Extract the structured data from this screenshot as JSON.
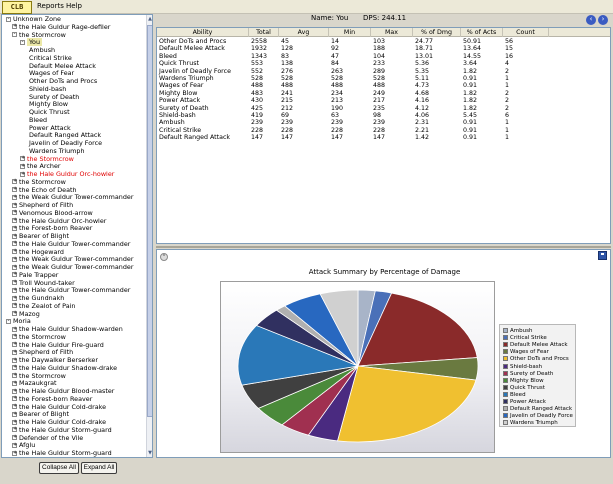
{
  "menu": {
    "logo": "CLB",
    "items": [
      "Reports",
      "Help"
    ]
  },
  "tree": {
    "rows": [
      {
        "label": "Unknown Zone",
        "level": 0,
        "box": "-",
        "color": "normal"
      },
      {
        "label": "the Hale Guldur Rage-defiler",
        "level": 1,
        "box": "+",
        "color": "normal"
      },
      {
        "label": "the Stormcrow",
        "level": 1,
        "box": "-",
        "color": "normal"
      },
      {
        "label": "You",
        "level": 2,
        "box": "-",
        "color": "selected"
      },
      {
        "label": "Ambush",
        "level": 3,
        "box": "",
        "color": "normal"
      },
      {
        "label": "Critical Strike",
        "level": 3,
        "box": "",
        "color": "normal"
      },
      {
        "label": "Default Melee Attack",
        "level": 3,
        "box": "",
        "color": "normal"
      },
      {
        "label": "Wages of Fear",
        "level": 3,
        "box": "",
        "color": "normal"
      },
      {
        "label": "Other DoTs and Procs",
        "level": 3,
        "box": "",
        "color": "normal"
      },
      {
        "label": "Shield-bash",
        "level": 3,
        "box": "",
        "color": "normal"
      },
      {
        "label": "Surety of Death",
        "level": 3,
        "box": "",
        "color": "normal"
      },
      {
        "label": "Mighty Blow",
        "level": 3,
        "box": "",
        "color": "normal"
      },
      {
        "label": "Quick Thrust",
        "level": 3,
        "box": "",
        "color": "normal"
      },
      {
        "label": "Bleed",
        "level": 3,
        "box": "",
        "color": "normal"
      },
      {
        "label": "Power Attack",
        "level": 3,
        "box": "",
        "color": "normal"
      },
      {
        "label": "Default Ranged Attack",
        "level": 3,
        "box": "",
        "color": "normal"
      },
      {
        "label": "Javelin of Deadly Force",
        "level": 3,
        "box": "",
        "color": "normal"
      },
      {
        "label": "Wardens Triumph",
        "level": 3,
        "box": "",
        "color": "normal"
      },
      {
        "label": "the Stormcrow",
        "level": 2,
        "box": "+",
        "color": "red"
      },
      {
        "label": "the Archer",
        "level": 2,
        "box": "+",
        "color": "normal"
      },
      {
        "label": "the Hale Guldur Orc-howler",
        "level": 2,
        "box": "+",
        "color": "red"
      },
      {
        "label": "the Stormcrow",
        "level": 1,
        "box": "+",
        "color": "normal"
      },
      {
        "label": "the Echo of Death",
        "level": 1,
        "box": "+",
        "color": "normal"
      },
      {
        "label": "the Weak Guldur Tower-commander",
        "level": 1,
        "box": "+",
        "color": "normal"
      },
      {
        "label": "Shepherd of Filth",
        "level": 1,
        "box": "+",
        "color": "normal"
      },
      {
        "label": "Venomous Blood-arrow",
        "level": 1,
        "box": "+",
        "color": "normal"
      },
      {
        "label": "the Hale Guldur Orc-howler",
        "level": 1,
        "box": "+",
        "color": "normal"
      },
      {
        "label": "the Forest-born Reaver",
        "level": 1,
        "box": "+",
        "color": "normal"
      },
      {
        "label": "Bearer of Blight",
        "level": 1,
        "box": "+",
        "color": "normal"
      },
      {
        "label": "the Hale Guldur Tower-commander",
        "level": 1,
        "box": "+",
        "color": "normal"
      },
      {
        "label": "the Hogeward",
        "level": 1,
        "box": "+",
        "color": "normal"
      },
      {
        "label": "the Weak Guldur Tower-commander",
        "level": 1,
        "box": "+",
        "color": "normal"
      },
      {
        "label": "the Weak Guldur Tower-commander",
        "level": 1,
        "box": "+",
        "color": "normal"
      },
      {
        "label": "Pale Trapper",
        "level": 1,
        "box": "+",
        "color": "normal"
      },
      {
        "label": "Troll Wound-taker",
        "level": 1,
        "box": "+",
        "color": "normal"
      },
      {
        "label": "the Hale Guldur Tower-commander",
        "level": 1,
        "box": "+",
        "color": "normal"
      },
      {
        "label": "the Gundnakh",
        "level": 1,
        "box": "+",
        "color": "normal"
      },
      {
        "label": "the Zealot of Pain",
        "level": 1,
        "box": "+",
        "color": "normal"
      },
      {
        "label": "Mazog",
        "level": 1,
        "box": "+",
        "color": "normal"
      },
      {
        "label": "Moria",
        "level": 0,
        "box": "-",
        "color": "normal"
      },
      {
        "label": "the Hale Guldur Shadow-warden",
        "level": 1,
        "box": "+",
        "color": "normal"
      },
      {
        "label": "the Stormcrow",
        "level": 1,
        "box": "+",
        "color": "normal"
      },
      {
        "label": "the Hale Guldur Fire-guard",
        "level": 1,
        "box": "+",
        "color": "normal"
      },
      {
        "label": "Shepherd of Filth",
        "level": 1,
        "box": "+",
        "color": "normal"
      },
      {
        "label": "the Daywalker Berserker",
        "level": 1,
        "box": "+",
        "color": "normal"
      },
      {
        "label": "the Hale Guldur Shadow-drake",
        "level": 1,
        "box": "+",
        "color": "normal"
      },
      {
        "label": "the Stormcrow",
        "level": 1,
        "box": "+",
        "color": "normal"
      },
      {
        "label": "Mazaukgrat",
        "level": 1,
        "box": "+",
        "color": "normal"
      },
      {
        "label": "the Hale Guldur Blood-master",
        "level": 1,
        "box": "+",
        "color": "normal"
      },
      {
        "label": "the Forest-born Reaver",
        "level": 1,
        "box": "+",
        "color": "normal"
      },
      {
        "label": "the Hale Guldur Cold-drake",
        "level": 1,
        "box": "+",
        "color": "normal"
      },
      {
        "label": "Bearer of Blight",
        "level": 1,
        "box": "+",
        "color": "normal"
      },
      {
        "label": "the Hale Guldur Cold-drake",
        "level": 1,
        "box": "+",
        "color": "normal"
      },
      {
        "label": "the Hale Guldur Storm-guard",
        "level": 1,
        "box": "+",
        "color": "normal"
      },
      {
        "label": "Defender of the Vile",
        "level": 1,
        "box": "+",
        "color": "normal"
      },
      {
        "label": "Afglu",
        "level": 1,
        "box": "+",
        "color": "normal"
      },
      {
        "label": "the Hale Guldur Storm-guard",
        "level": 1,
        "box": "+",
        "color": "normal"
      }
    ]
  },
  "buttons": {
    "collapse_all": "Collapse All",
    "expand_all": "Expand All"
  },
  "header": {
    "name_label": "Name: You",
    "dps_label": "DPS: 244.11"
  },
  "table": {
    "columns": [
      "Ability",
      "Total",
      "Avg",
      "Min",
      "Max",
      "% of Dmg",
      "% of Acts",
      "Count"
    ],
    "rows": [
      [
        "Other DoTs and Procs",
        "2558",
        "45",
        "14",
        "103",
        "24.77",
        "50.91",
        "56"
      ],
      [
        "Default Melee Attack",
        "1932",
        "128",
        "92",
        "188",
        "18.71",
        "13.64",
        "15"
      ],
      [
        "Bleed",
        "1343",
        "83",
        "47",
        "104",
        "13.01",
        "14.55",
        "16"
      ],
      [
        "Quick Thrust",
        "553",
        "138",
        "84",
        "233",
        "5.36",
        "3.64",
        "4"
      ],
      [
        "Javelin of Deadly Force",
        "552",
        "276",
        "263",
        "289",
        "5.35",
        "1.82",
        "2"
      ],
      [
        "Wardens Triumph",
        "528",
        "528",
        "528",
        "528",
        "5.11",
        "0.91",
        "1"
      ],
      [
        "Wages of Fear",
        "488",
        "488",
        "488",
        "488",
        "4.73",
        "0.91",
        "1"
      ],
      [
        "Mighty Blow",
        "483",
        "241",
        "234",
        "249",
        "4.68",
        "1.82",
        "2"
      ],
      [
        "Power Attack",
        "430",
        "215",
        "213",
        "217",
        "4.16",
        "1.82",
        "2"
      ],
      [
        "Surety of Death",
        "425",
        "212",
        "190",
        "235",
        "4.12",
        "1.82",
        "2"
      ],
      [
        "Shield-bash",
        "419",
        "69",
        "63",
        "98",
        "4.06",
        "5.45",
        "6"
      ],
      [
        "Ambush",
        "239",
        "239",
        "239",
        "239",
        "2.31",
        "0.91",
        "1"
      ],
      [
        "Critical Strike",
        "228",
        "228",
        "228",
        "228",
        "2.21",
        "0.91",
        "1"
      ],
      [
        "Default Ranged Attack",
        "147",
        "147",
        "147",
        "147",
        "1.42",
        "0.91",
        "1"
      ]
    ]
  },
  "chart_data": {
    "type": "pie",
    "title": "Attack Summary by Percentage of Damage",
    "legend_position": "right",
    "slices": [
      {
        "name": "Ambush",
        "value": 2.31,
        "color": "#a8b4c8"
      },
      {
        "name": "Critical Strike",
        "value": 2.21,
        "color": "#4a70b8"
      },
      {
        "name": "Default Melee Attack",
        "value": 18.71,
        "color": "#8a2a2a"
      },
      {
        "name": "Wages of Fear",
        "value": 4.73,
        "color": "#6a7a40"
      },
      {
        "name": "Other DoTs and Procs",
        "value": 24.77,
        "color": "#f0c030"
      },
      {
        "name": "Shield-bash",
        "value": 4.06,
        "color": "#4a2a80"
      },
      {
        "name": "Surety of Death",
        "value": 4.12,
        "color": "#a03050"
      },
      {
        "name": "Mighty Blow",
        "value": 4.68,
        "color": "#4a8a3a"
      },
      {
        "name": "Quick Thrust",
        "value": 5.36,
        "color": "#404040"
      },
      {
        "name": "Bleed",
        "value": 13.01,
        "color": "#2a78b8"
      },
      {
        "name": "Power Attack",
        "value": 4.16,
        "color": "#303060"
      },
      {
        "name": "Default Ranged Attack",
        "value": 1.42,
        "color": "#b0b0b0"
      },
      {
        "name": "Javelin of Deadly Force",
        "value": 5.35,
        "color": "#2868c0"
      },
      {
        "name": "Wardens Triumph",
        "value": 5.11,
        "color": "#d0d0d0"
      }
    ]
  }
}
